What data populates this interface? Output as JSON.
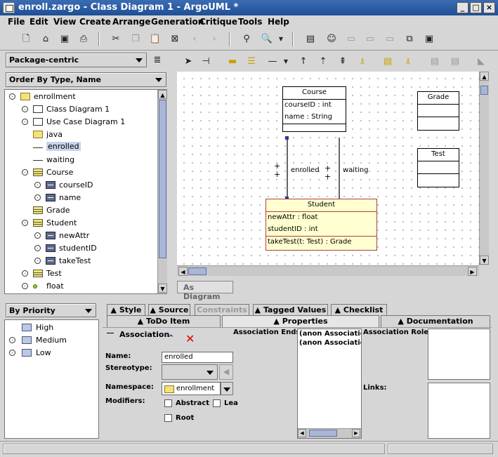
{
  "window": {
    "title": "enroll.zargo - Class Diagram 1 - ArgoUML *",
    "buttons": [
      "_",
      "□",
      "×"
    ]
  },
  "menus": [
    "File",
    "Edit",
    "View",
    "Create",
    "Arrange",
    "Generation",
    "Critique",
    "Tools",
    "Help"
  ],
  "toolbar_icons": [
    "new-file-icon",
    "open-file-icon",
    "save-icon",
    "print-icon",
    "cut-icon",
    "copy-icon",
    "paste-icon",
    "delete-icon",
    "back-icon",
    "forward-icon",
    "find-icon",
    "zoom-icon",
    "class-diagram-icon",
    "usecase-diagram-icon",
    "state-diagram-icon",
    "activity-diagram-icon",
    "collaboration-diagram-icon",
    "deployment-diagram-icon"
  ],
  "explorer": {
    "perspective": "Package-centric",
    "order": "Order By Type, Name",
    "tree": [
      {
        "label": "enrollment",
        "icon": "folder",
        "indent": 0
      },
      {
        "label": "Class Diagram 1",
        "icon": "diag",
        "indent": 1
      },
      {
        "label": "Use Case Diagram 1",
        "icon": "diag",
        "indent": 1
      },
      {
        "label": "java",
        "icon": "folder",
        "indent": 1
      },
      {
        "label": "enrolled",
        "icon": "line",
        "indent": 1,
        "selected": true
      },
      {
        "label": "waiting",
        "icon": "line",
        "indent": 1
      },
      {
        "label": "Course",
        "icon": "class",
        "indent": 1
      },
      {
        "label": "courseID",
        "icon": "attr",
        "indent": 2
      },
      {
        "label": "name",
        "icon": "attr",
        "indent": 2
      },
      {
        "label": "Grade",
        "icon": "class",
        "indent": 1
      },
      {
        "label": "Student",
        "icon": "class",
        "indent": 1
      },
      {
        "label": "newAttr",
        "icon": "attr",
        "indent": 2
      },
      {
        "label": "studentID",
        "icon": "attr",
        "indent": 2
      },
      {
        "label": "takeTest",
        "icon": "attr",
        "indent": 2
      },
      {
        "label": "Test",
        "icon": "class",
        "indent": 1
      },
      {
        "label": "float",
        "icon": "dot",
        "indent": 1
      }
    ]
  },
  "todo": {
    "sort": "By Priority",
    "items": [
      {
        "label": "High"
      },
      {
        "label": "Medium"
      },
      {
        "label": "Low"
      }
    ]
  },
  "diagram": {
    "tab_label": "As Diagram",
    "classes": {
      "course": {
        "name": "Course",
        "attrs": [
          "courseID : int",
          "name : String"
        ],
        "ops": []
      },
      "grade": {
        "name": "Grade",
        "attrs": [],
        "ops": []
      },
      "test": {
        "name": "Test",
        "attrs": [],
        "ops": []
      },
      "student": {
        "name": "Student",
        "attrs": [
          "newAttr : float",
          "studentID : int"
        ],
        "ops": [
          "takeTest(t: Test) : Grade"
        ]
      }
    },
    "assoc_labels": {
      "enrolled": "enrolled",
      "waiting": "waiting",
      "plus": "+"
    }
  },
  "details": {
    "tabs_top": [
      "Style",
      "Source",
      "Constraints",
      "Tagged Values",
      "Checklist"
    ],
    "tabs_bottom": [
      "ToDo Item",
      "Properties",
      "Documentation"
    ],
    "heading": "Association",
    "name_label": "Name:",
    "name_value": "enrolled",
    "stereotype_label": "Stereotype:",
    "namespace_label": "Namespace:",
    "namespace_value": "enrollment",
    "modifiers_label": "Modifiers:",
    "abstract_label": "Abstract",
    "leaf_label": "Lea",
    "root_label": "Root",
    "ends_label": "Association Ends:",
    "ends": [
      "(anon Association",
      "(anon Association"
    ],
    "roles_label": "Association Roles:",
    "links_label": "Links:"
  }
}
